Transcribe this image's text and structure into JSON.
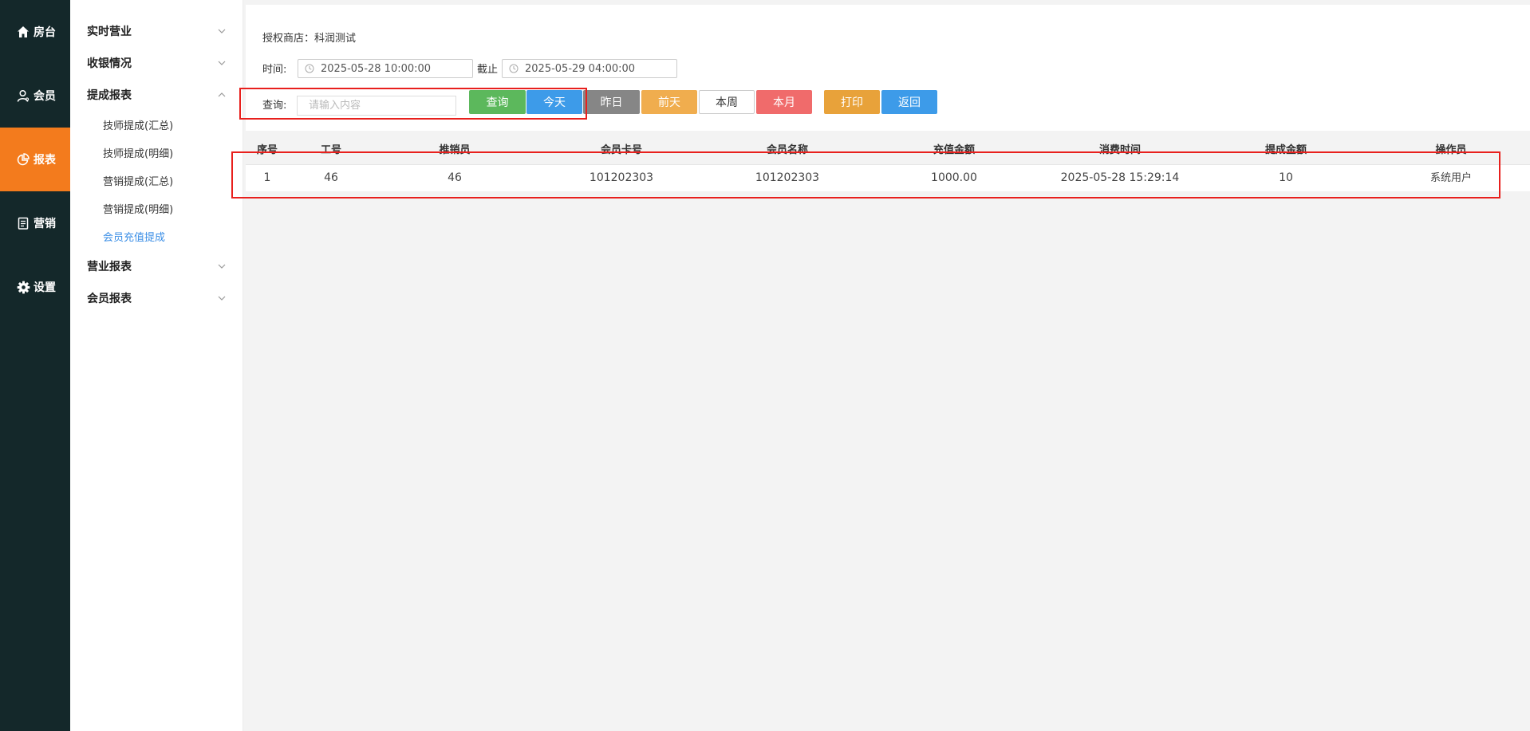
{
  "nav": [
    {
      "label": "房台",
      "icon": "home-icon"
    },
    {
      "label": "会员",
      "icon": "user-icon"
    },
    {
      "label": "报表",
      "icon": "chart-icon"
    },
    {
      "label": "营销",
      "icon": "clipboard-icon"
    },
    {
      "label": "设置",
      "icon": "gear-icon"
    }
  ],
  "nav_active_color": "#f37b1d",
  "menu": {
    "groups": [
      "实时营业",
      "收银情况",
      "提成报表",
      "营业报表",
      "会员报表"
    ],
    "sub_items": [
      "技师提成(汇总)",
      "技师提成(明细)",
      "营销提成(汇总)",
      "营销提成(明细)",
      "会员充值提成"
    ],
    "active_sub_color": "#3a8ee6"
  },
  "filters": {
    "store_label": "授权商店：",
    "store_value": "科润测试",
    "time_label": "时间:",
    "start_date": "2025-05-28 10:00:00",
    "end_label": "截止",
    "end_date": "2025-05-29 04:00:00",
    "query_label": "查询:",
    "search_placeholder": "请输入内容"
  },
  "buttons": {
    "search": "查询",
    "today": "今天",
    "yesterday": "昨日",
    "day_before": "前天",
    "this_week": "本周",
    "this_month": "本月",
    "print": "打印",
    "back": "返回"
  },
  "button_colors": {
    "search": "#5cb85c",
    "today": "#3d9be9",
    "yesterday": "#868686",
    "day_before": "#f0ad4e",
    "this_week": "#ffffff",
    "this_month": "#f06b6b",
    "print": "#e8a23a",
    "back": "#3d9be9"
  },
  "table": {
    "columns": [
      "序号",
      "工号",
      "推销员",
      "会员卡号",
      "会员名称",
      "充值金额",
      "消费时间",
      "提成金额",
      "操作员"
    ],
    "rows": [
      [
        "1",
        "46",
        "46",
        "101202303",
        "101202303",
        "1000.00",
        "2025-05-28 15:29:14",
        "10",
        "系统用户"
      ]
    ]
  },
  "highlight_color": "#e8201d"
}
